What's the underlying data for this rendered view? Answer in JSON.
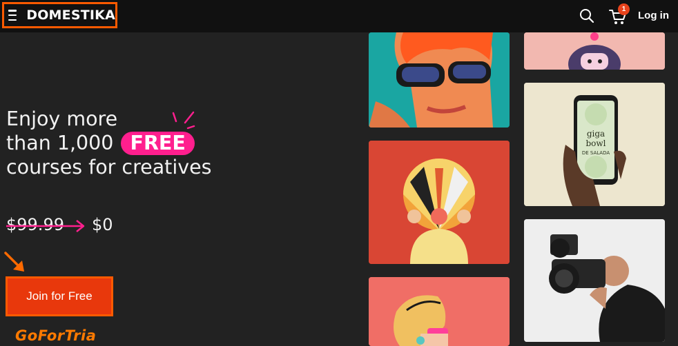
{
  "header": {
    "brand": "DOMESTIKA",
    "login_label": "Log in",
    "cart_count": "1",
    "icons": [
      "menu-icon",
      "search-icon",
      "cart-icon"
    ]
  },
  "hero": {
    "line1": "Enjoy more",
    "line2_pre": "than 1,000",
    "free_label": "FREE",
    "line3": "courses for creatives",
    "old_price": "$99.99",
    "new_price": "$0",
    "cta_label": "Join for Free"
  },
  "watermark": "GoForTrial",
  "colors": {
    "background": "#222222",
    "header": "#111111",
    "accent_pink": "#ff1f8e",
    "cta": "#e8380c",
    "highlight_orange": "#ff5a00"
  }
}
